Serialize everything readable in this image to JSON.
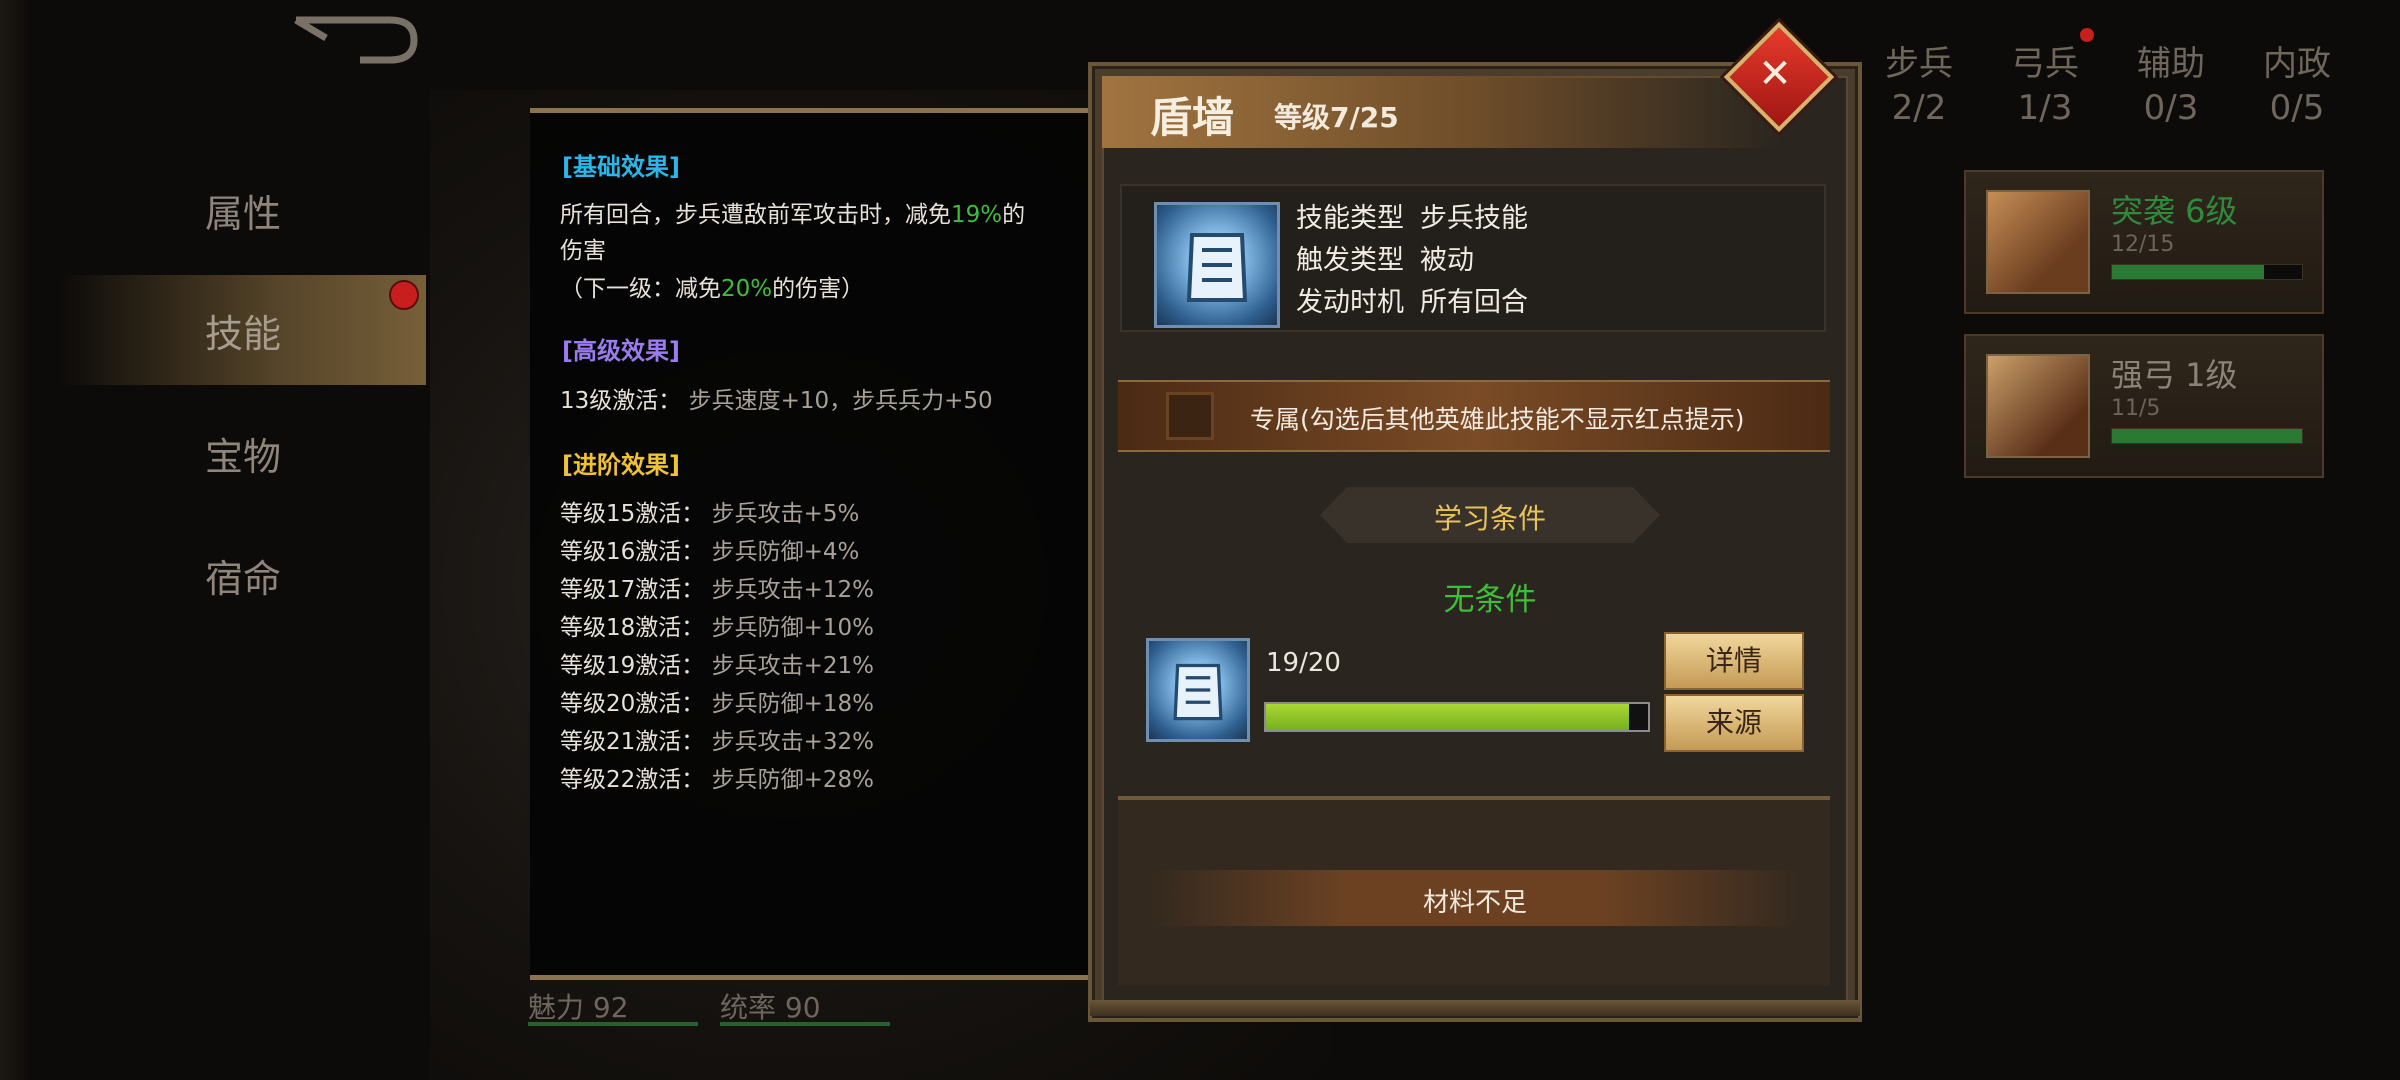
{
  "sidebar": {
    "tabs": [
      {
        "label": "属性"
      },
      {
        "label": "技能"
      },
      {
        "label": "宝物"
      },
      {
        "label": "宿命"
      }
    ]
  },
  "categories": [
    {
      "label": "步兵",
      "count": "2/2"
    },
    {
      "label": "弓兵",
      "count": "1/3"
    },
    {
      "label": "辅助",
      "count": "0/3"
    },
    {
      "label": "内政",
      "count": "0/5"
    }
  ],
  "skill_cards": [
    {
      "name": "突袭 6级",
      "progress": "12/15",
      "progress_fraction": 0.8
    },
    {
      "name": "强弓 1级",
      "progress": "11/5",
      "progress_fraction": 1.0
    }
  ],
  "hero_stats": {
    "charm": "魅力 92",
    "command": "统率 90"
  },
  "detail": {
    "basic_header": "[基础效果]",
    "basic_line1_a": "所有回合，步兵遭敌前军攻击时，减免",
    "basic_line1_val": "19%",
    "basic_line1_b": "的",
    "basic_line2": "伤害",
    "basic_next_a": "（下一级：减免",
    "basic_next_val": "20%",
    "basic_next_b": "的伤害）",
    "advanced_header": "[高级效果]",
    "advanced_label": "13级激活：",
    "advanced_value": "步兵速度+10，步兵兵力+50",
    "promote_header": "[进阶效果]",
    "promote_lines": [
      {
        "label": "等级15激活：",
        "value": "步兵攻击+5%"
      },
      {
        "label": "等级16激活：",
        "value": "步兵防御+4%"
      },
      {
        "label": "等级17激活：",
        "value": "步兵攻击+12%"
      },
      {
        "label": "等级18激活：",
        "value": "步兵防御+10%"
      },
      {
        "label": "等级19激活：",
        "value": "步兵攻击+21%"
      },
      {
        "label": "等级20激活：",
        "value": "步兵防御+18%"
      },
      {
        "label": "等级21激活：",
        "value": "步兵攻击+32%"
      },
      {
        "label": "等级22激活：",
        "value": "步兵防御+28%"
      }
    ]
  },
  "dialog": {
    "skill_name": "盾墙",
    "level": "等级7/25",
    "info": [
      {
        "key": "技能类型",
        "value": "步兵技能"
      },
      {
        "key": "触发类型",
        "value": "被动"
      },
      {
        "key": "发动时机",
        "value": "所有回合"
      }
    ],
    "exclusive_label": "专属(勾选后其他英雄此技能不显示红点提示)",
    "condition_title": "学习条件",
    "condition_value": "无条件",
    "material_count": "19/20",
    "material_fraction": 0.95,
    "details_button": "详情",
    "source_button": "来源",
    "status": "材料不足"
  },
  "colors": {
    "green_text": "#3fbf39",
    "cyan_header": "#29b6e8",
    "purple_header": "#9b7cf0",
    "gold_header": "#f1c232"
  }
}
